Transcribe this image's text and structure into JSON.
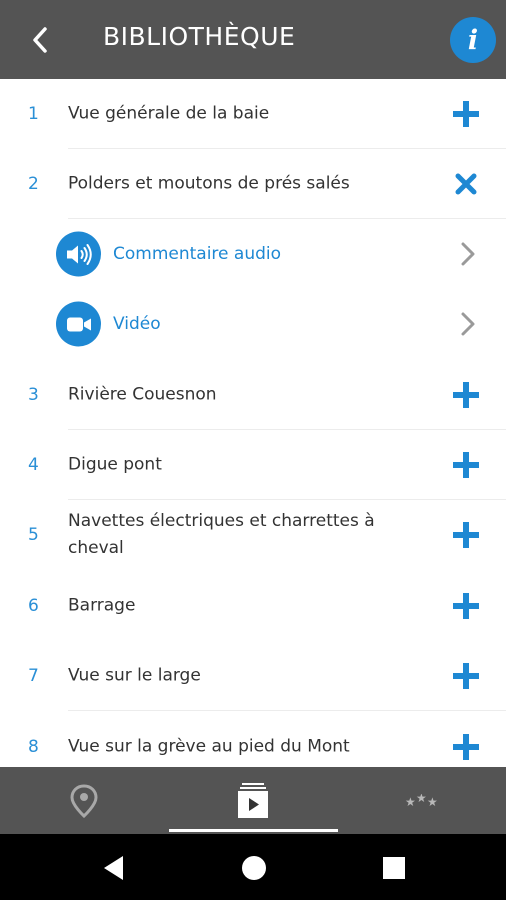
{
  "header": {
    "title": "BIBLIOTHÈQUE",
    "back_icon": "chevron-left-icon",
    "info_icon": "info-icon",
    "info_glyph": "i",
    "accent_color": "#1e88d3",
    "background_color": "#545454"
  },
  "items": [
    {
      "number": "1",
      "label": "Vue générale de la baie",
      "action": "plus"
    },
    {
      "number": "2",
      "label": "Polders et moutons de prés salés",
      "action": "close"
    },
    {
      "number": "3",
      "label": "Rivière Couesnon",
      "action": "plus"
    },
    {
      "number": "4",
      "label": "Digue pont",
      "action": "plus"
    },
    {
      "number": "5",
      "label": "Navettes électriques et charrettes à cheval",
      "action": "plus"
    },
    {
      "number": "6",
      "label": "Barrage",
      "action": "plus"
    },
    {
      "number": "7",
      "label": "Vue sur le large",
      "action": "plus"
    },
    {
      "number": "8",
      "label": "Vue sur la grève au pied du Mont",
      "action": "plus"
    }
  ],
  "expanded_item": {
    "media": [
      {
        "label": "Commentaire audio",
        "icon": "speaker-icon"
      },
      {
        "label": "Vidéo",
        "icon": "video-camera-icon"
      }
    ]
  },
  "tabbar": {
    "tabs": [
      {
        "name": "map",
        "icon": "map-pin-icon"
      },
      {
        "name": "library",
        "icon": "media-library-icon",
        "selected": true
      },
      {
        "name": "stars",
        "icon": "stars-icon"
      }
    ]
  },
  "system_nav": {
    "buttons": [
      "back-triangle-icon",
      "home-circle-icon",
      "recents-square-icon"
    ]
  }
}
